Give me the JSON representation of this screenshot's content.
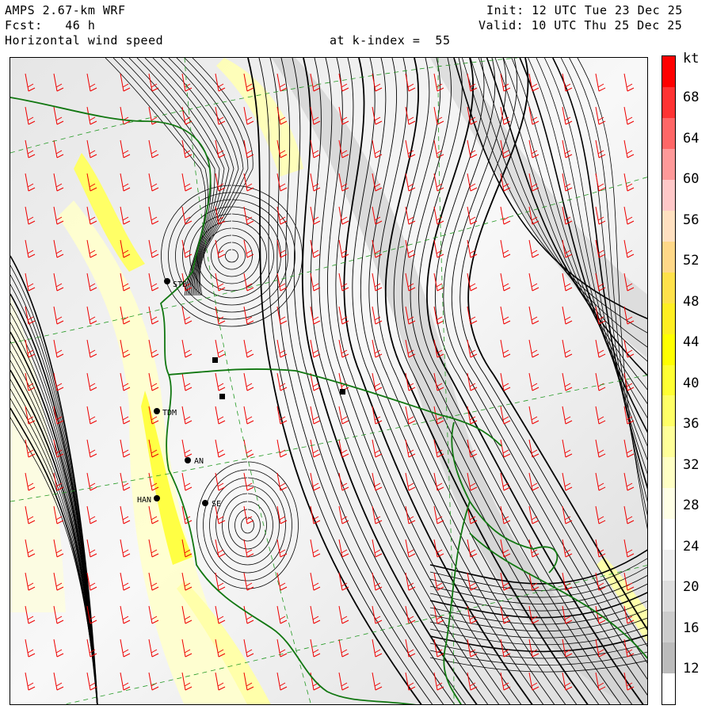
{
  "header": {
    "model": "AMPS 2.67-km WRF",
    "init": "Init: 12 UTC Tue 23 Dec 25",
    "fcst": "Fcst:   46 h",
    "valid": "Valid: 10 UTC Thu 25 Dec 25",
    "field": "Horizontal wind speed",
    "level": "at k-index =  55"
  },
  "colorbar": {
    "unit": "kt",
    "labels": [
      "68",
      "64",
      "60",
      "56",
      "52",
      "48",
      "44",
      "40",
      "36",
      "32",
      "28",
      "24",
      "20",
      "16",
      "12"
    ],
    "colors": [
      "#ff0000",
      "#ff3333",
      "#ff6666",
      "#ff9999",
      "#ffc8c8",
      "#ffe0c0",
      "#ffd888",
      "#ffe14a",
      "#ffee22",
      "#ffff00",
      "#ffff33",
      "#ffff66",
      "#ffff99",
      "#ffffc4",
      "#ffffe6",
      "#ffffff",
      "#eeeeee",
      "#dddddd",
      "#cccccc",
      "#bbbbbb",
      "#ffffff"
    ]
  },
  "stations": [
    {
      "name": "STB"
    },
    {
      "name": "TDM"
    },
    {
      "name": "HAN"
    },
    {
      "name": "SE"
    },
    {
      "name": "AN"
    }
  ],
  "icons": {
    "station": "station-dot-icon"
  }
}
